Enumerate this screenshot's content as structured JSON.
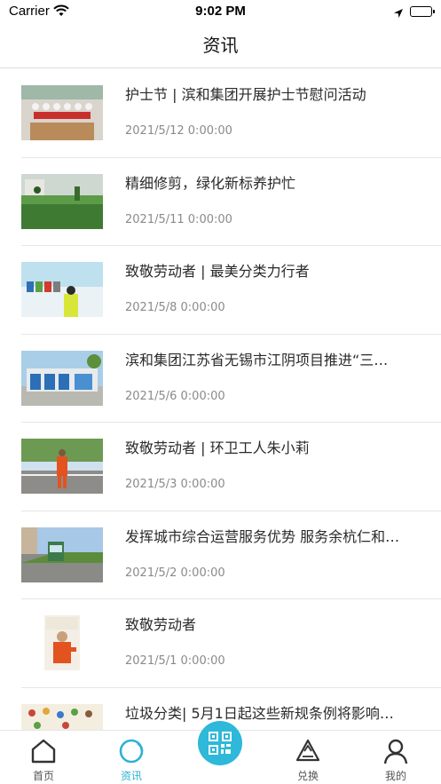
{
  "status_bar": {
    "carrier": "Carrier",
    "time": "9:02 PM"
  },
  "nav": {
    "title": "资讯"
  },
  "news": [
    {
      "title": "护士节 | 滨和集团开展护士节慰问活动",
      "date": "2021/5/12 0:00:00"
    },
    {
      "title": "精细修剪，绿化新标养护忙",
      "date": "2021/5/11 0:00:00"
    },
    {
      "title": "致敬劳动者 | 最美分类力行者",
      "date": "2021/5/8 0:00:00"
    },
    {
      "title": "滨和集团江苏省无锡市江阴项目推进“三…",
      "date": "2021/5/6 0:00:00"
    },
    {
      "title": "致敬劳动者 | 环卫工人朱小莉",
      "date": "2021/5/3 0:00:00"
    },
    {
      "title": "发挥城市综合运营服务优势 服务余杭仁和…",
      "date": "2021/5/2 0:00:00"
    },
    {
      "title": "致敬劳动者",
      "date": "2021/5/1 0:00:00"
    },
    {
      "title": "垃圾分类| 5月1日起这些新规条例将影响…",
      "date": ""
    }
  ],
  "tabs": {
    "home": "首页",
    "news": "资讯",
    "exchange": "兑换",
    "mine": "我的"
  },
  "colors": {
    "accent": "#2eb8d9",
    "active_label": "#2eb1d6",
    "divider": "#e6e6e6"
  }
}
